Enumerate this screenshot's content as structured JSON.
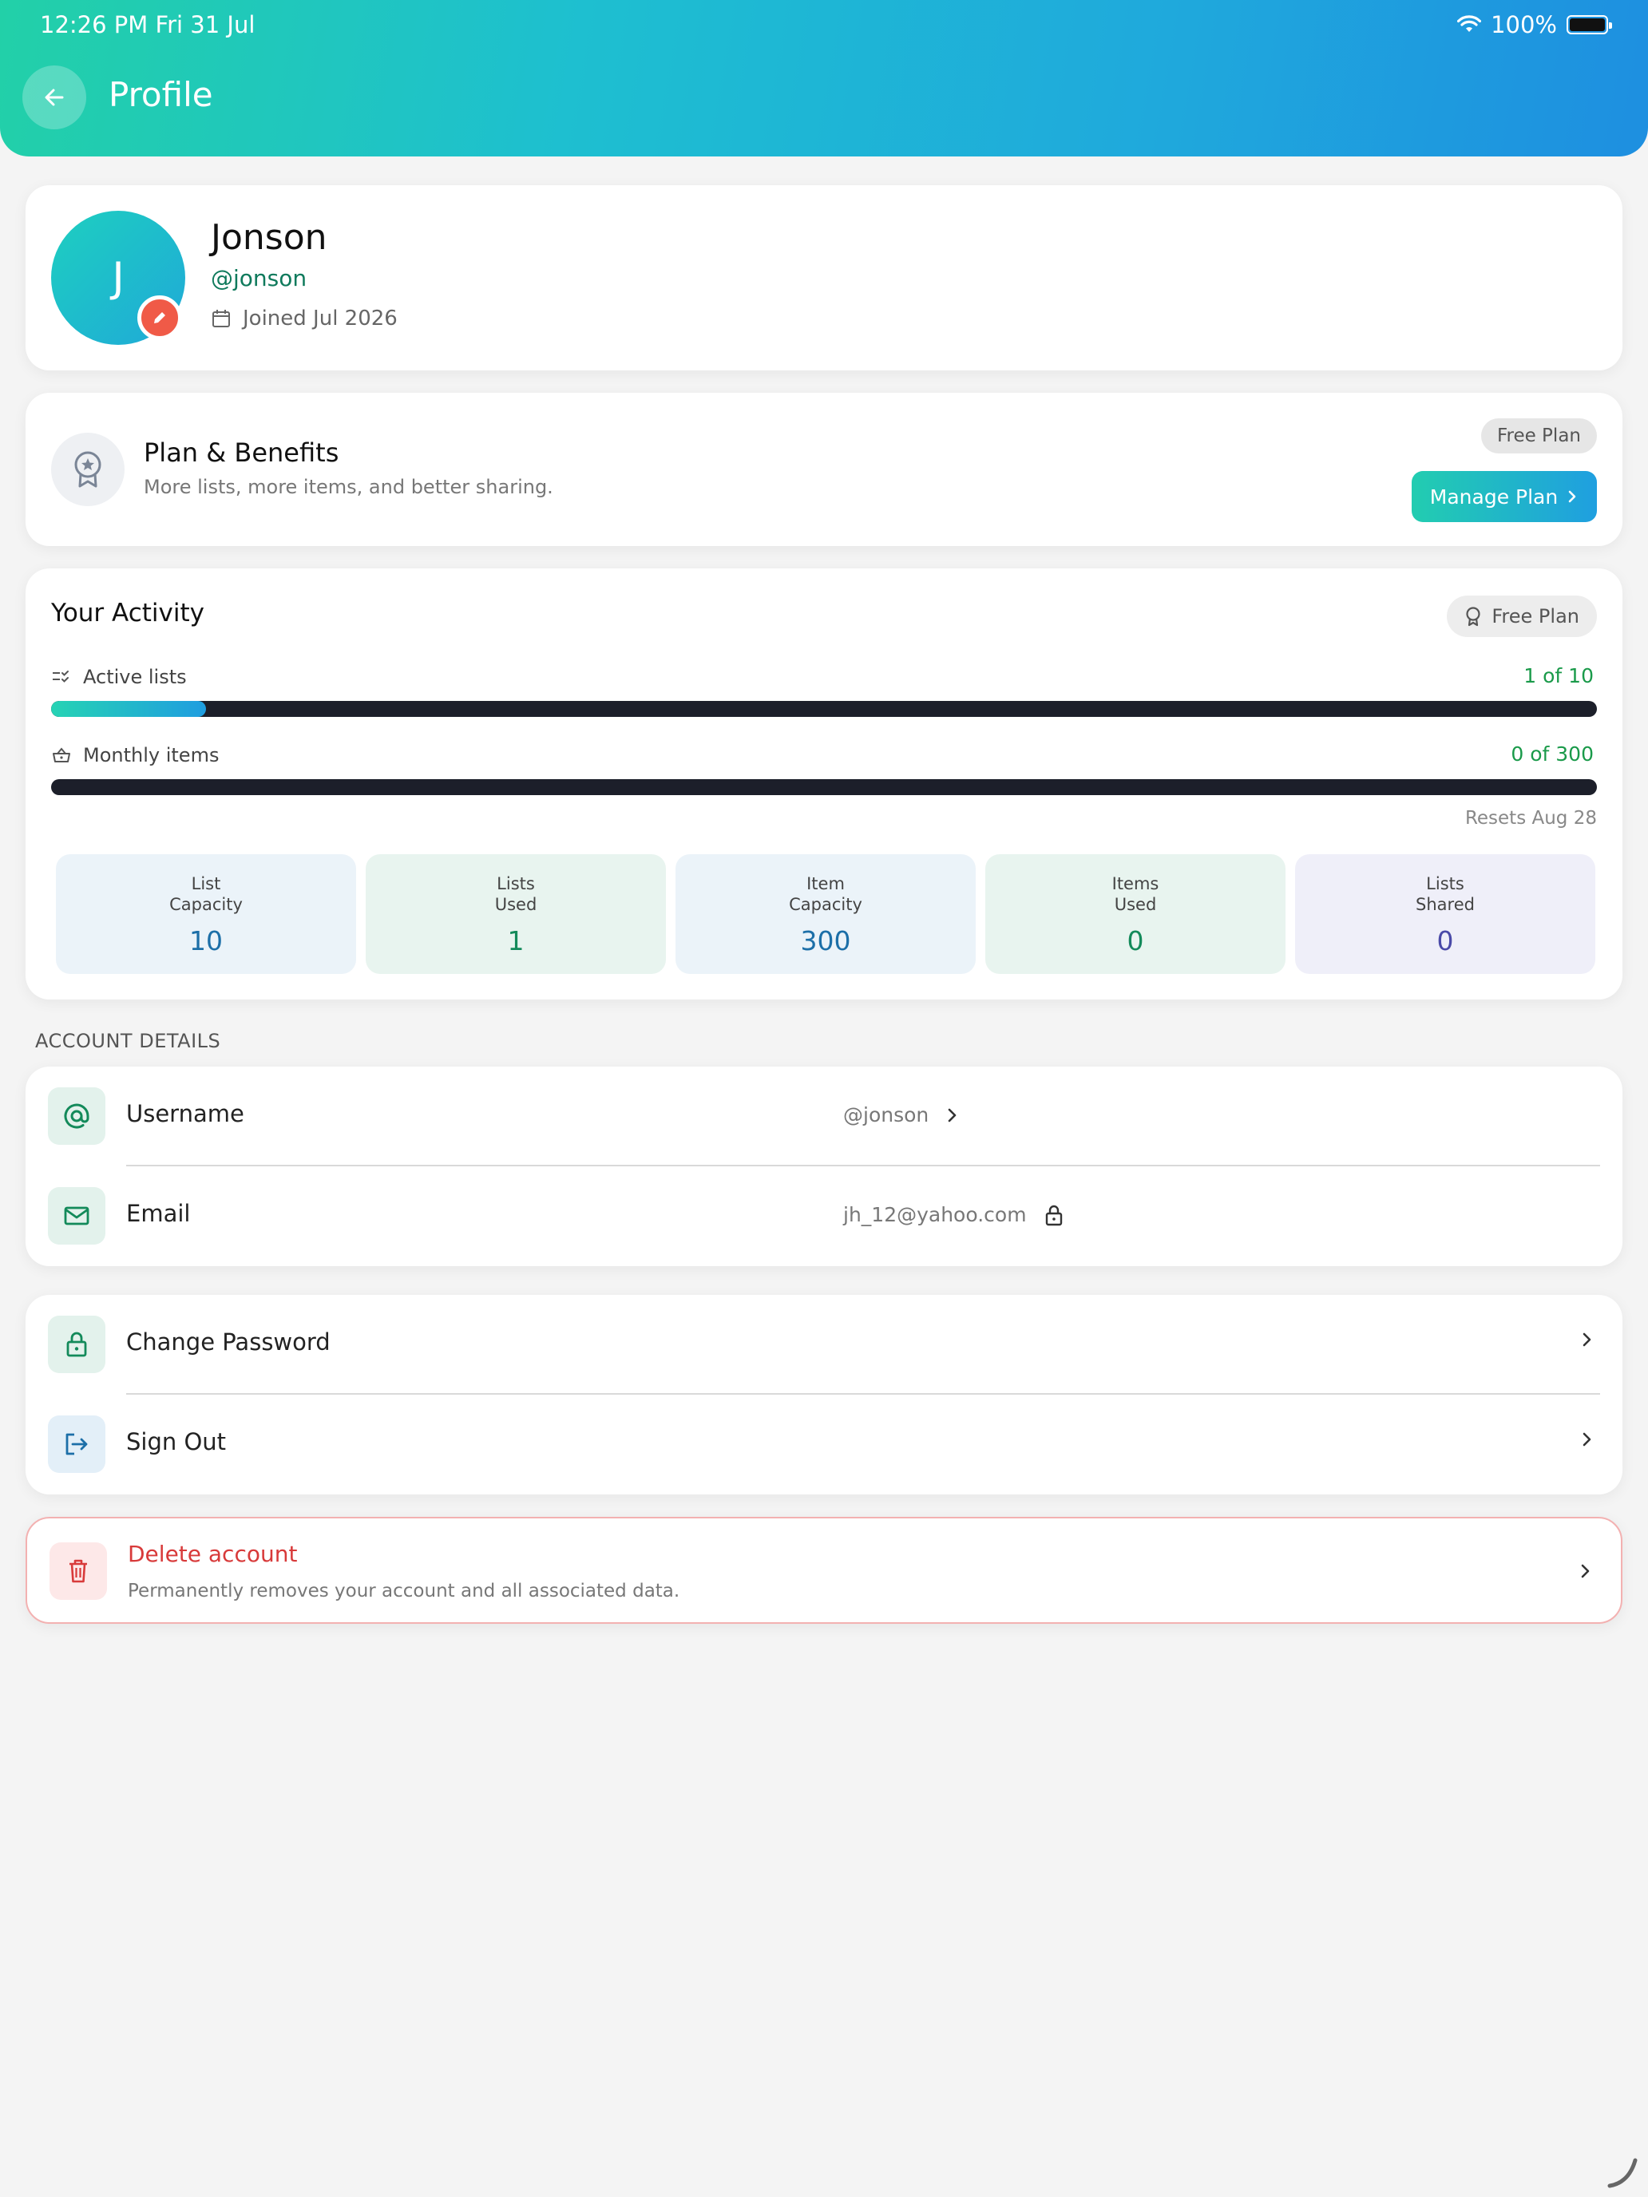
{
  "status_bar": {
    "time": "12:26 PM   Fri 31 Jul",
    "battery": "100%"
  },
  "header": {
    "title": "Profile"
  },
  "profile": {
    "initial": "J",
    "name": "Jonson",
    "handle": "@jonson",
    "joined": "Joined Jul 2026"
  },
  "plan": {
    "title": "Plan & Benefits",
    "subtitle": "More lists, more items, and better sharing.",
    "badge": "Free Plan",
    "manage_label": "Manage Plan"
  },
  "activity": {
    "title": "Your Activity",
    "badge": "Free Plan",
    "meters": [
      {
        "label": "Active lists",
        "value_text": "1 of 10",
        "used": 1,
        "max": 10
      },
      {
        "label": "Monthly items",
        "value_text": "0 of 300",
        "used": 0,
        "max": 300
      }
    ],
    "resets": "Resets Aug 28",
    "stats": [
      {
        "line1": "List",
        "line2": "Capacity",
        "value": "10"
      },
      {
        "line1": "Lists",
        "line2": "Used",
        "value": "1"
      },
      {
        "line1": "Item",
        "line2": "Capacity",
        "value": "300"
      },
      {
        "line1": "Items",
        "line2": "Used",
        "value": "0"
      },
      {
        "line1": "Lists",
        "line2": "Shared",
        "value": "0"
      }
    ]
  },
  "account_details": {
    "section_label": "ACCOUNT DETAILS",
    "username_label": "Username",
    "username_value": "@jonson",
    "email_label": "Email",
    "email_value": "jh_12@yahoo.com"
  },
  "security": {
    "change_password": "Change Password",
    "sign_out": "Sign Out"
  },
  "danger": {
    "title": "Delete account",
    "subtitle": "Permanently removes your account and all associated data."
  },
  "colors": {
    "accent_green": "#0f7a5c",
    "danger": "#d83a3a",
    "gradient_start": "#22d0a8",
    "gradient_end": "#1e8fe0"
  }
}
